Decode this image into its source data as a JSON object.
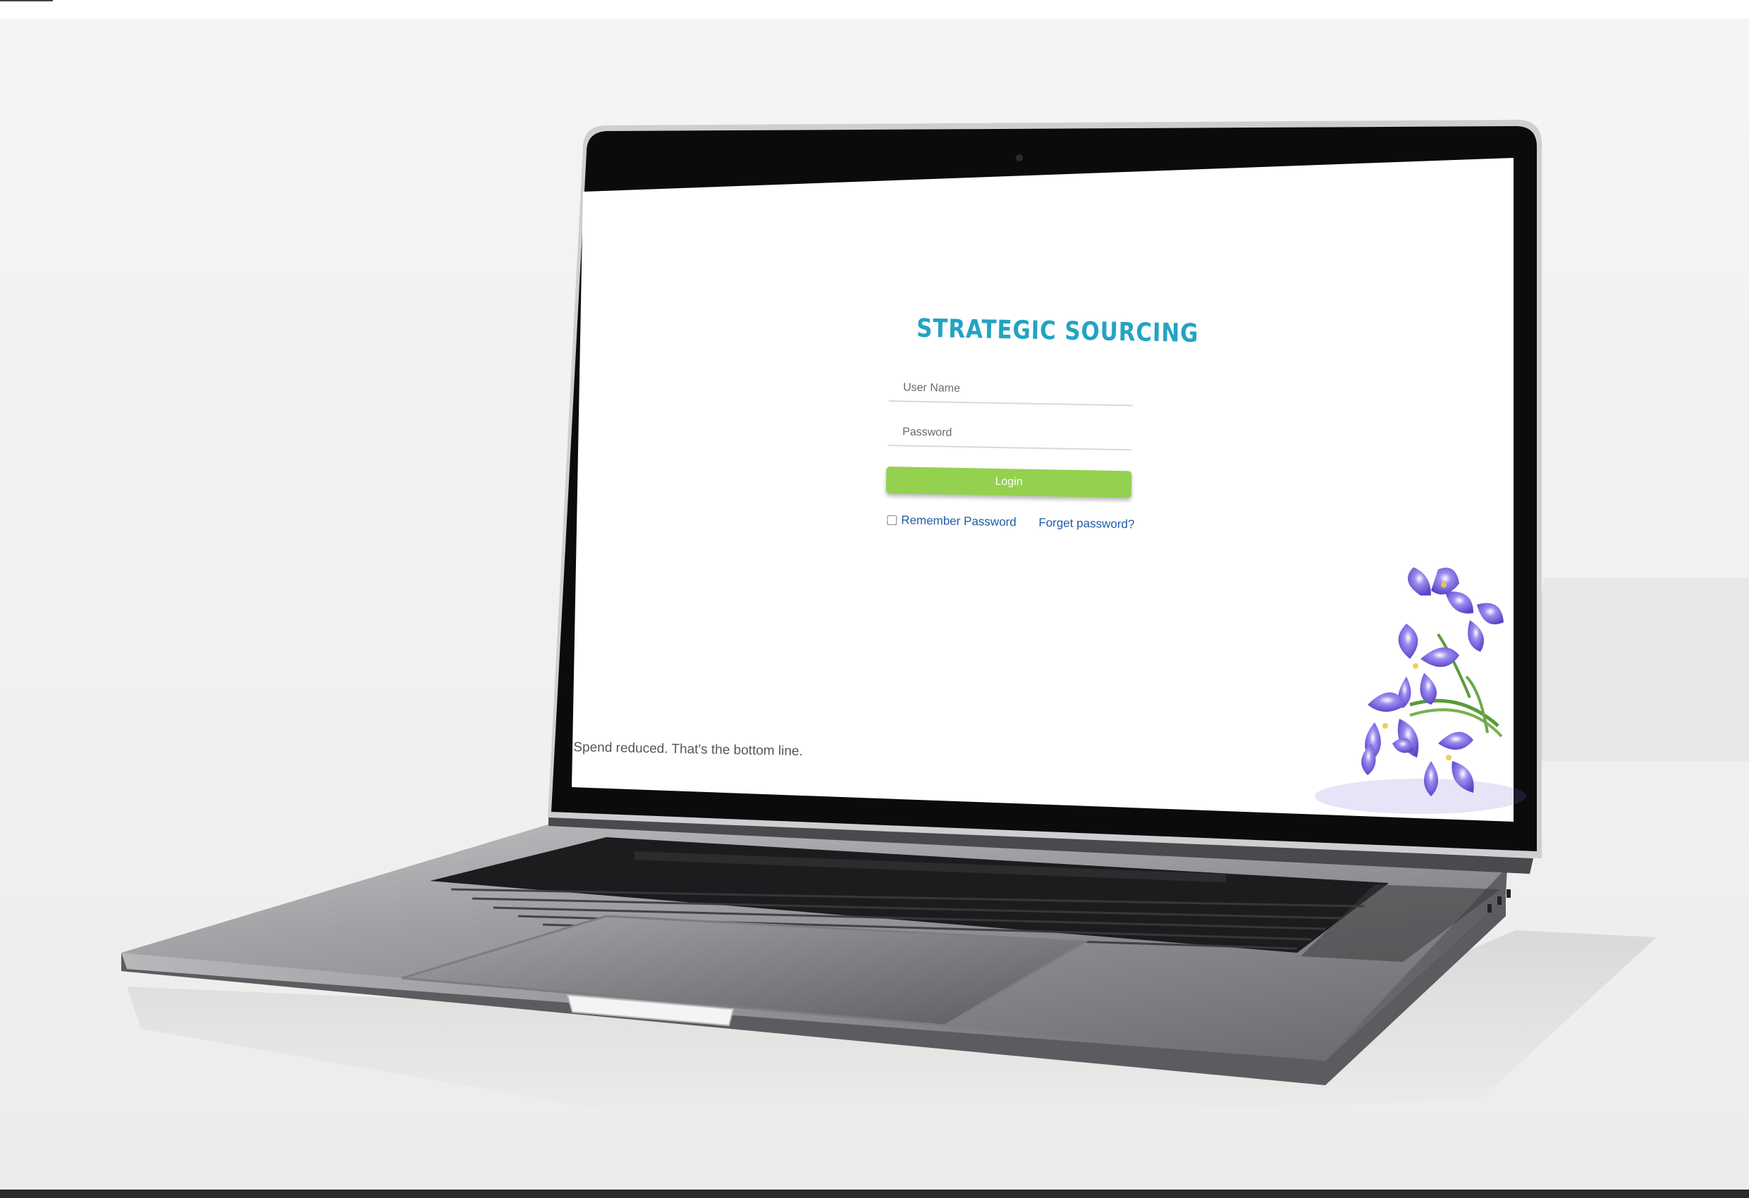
{
  "login_page": {
    "title": "STRATEGIC SOURCING",
    "username_placeholder": "User Name",
    "password_placeholder": "Password",
    "login_label": "Login",
    "remember_label": "Remember Password",
    "forgot_label": "Forget password?",
    "tagline": "Spend reduced. That's the bottom line."
  },
  "colors": {
    "title": "#23a3c3",
    "login_button": "#93d14f",
    "link": "#1f5ba8",
    "flower": "#7b68d8"
  },
  "icons": [
    "camera-icon",
    "iris-flower-decoration",
    "laptop"
  ]
}
